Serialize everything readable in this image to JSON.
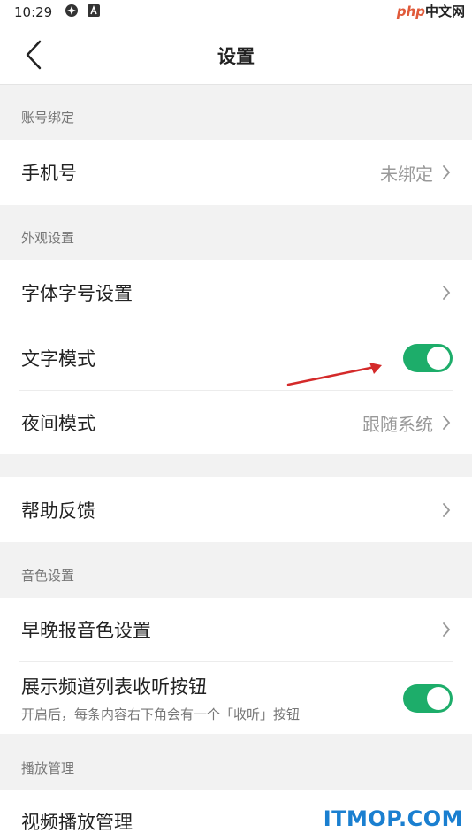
{
  "status_bar": {
    "time": "10:29",
    "icons": [
      "settings-pinwheel-icon",
      "a-badge-icon"
    ]
  },
  "watermark_top": {
    "php": "php",
    "cn": "中文网"
  },
  "header": {
    "title": "设置",
    "back_icon": "chevron-left-icon"
  },
  "sections": {
    "account": {
      "label": "账号绑定",
      "phone": {
        "label": "手机号",
        "value": "未绑定"
      }
    },
    "appearance": {
      "label": "外观设置",
      "font": {
        "label": "字体字号设置"
      },
      "text_mode": {
        "label": "文字模式",
        "enabled": true
      },
      "night_mode": {
        "label": "夜间模式",
        "value": "跟随系统"
      }
    },
    "help": {
      "label": "帮助反馈"
    },
    "voice": {
      "label": "音色设置",
      "voice_setting": {
        "label": "早晚报音色设置"
      },
      "show_listen": {
        "label": "展示频道列表收听按钮",
        "sub": "开启后，每条内容右下角会有一个「收听」按钮",
        "enabled": true
      }
    },
    "playback": {
      "label": "播放管理",
      "video": {
        "label": "视频播放管理"
      }
    }
  },
  "colors": {
    "toggle_on": "#1dad6a",
    "annotation_arrow": "#d42a2a"
  },
  "watermark_bottom": "ITMOP.COM"
}
